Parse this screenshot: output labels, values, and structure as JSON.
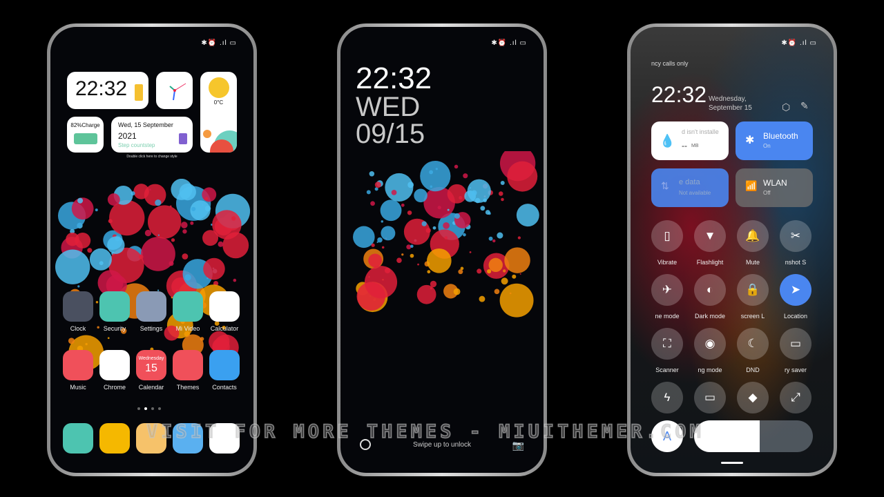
{
  "status_icons": "✱⏰ .ıl ▭",
  "home": {
    "clock_widget": "22:32",
    "weather_temp": "0°C",
    "charge": "82%Charge",
    "date_line": "Wed, 15 September",
    "year": "2021",
    "steps": "Step countstep",
    "hint": "Double click here to change style",
    "apps_row1": [
      {
        "label": "Clock",
        "color": "#4a5060"
      },
      {
        "label": "Security",
        "color": "#4dc4b0"
      },
      {
        "label": "Settings",
        "color": "#8a9ab5"
      },
      {
        "label": "Mi Video",
        "color": "#4dc4b0"
      },
      {
        "label": "Calculator",
        "color": "#ffffff"
      }
    ],
    "apps_row2": [
      {
        "label": "Music",
        "color": "#f0505a"
      },
      {
        "label": "Chrome",
        "color": "#ffffff"
      },
      {
        "label": "Calendar",
        "color": "#f0505a"
      },
      {
        "label": "Themes",
        "color": "#f0505a"
      },
      {
        "label": "Contacts",
        "color": "#3aa0f0"
      }
    ],
    "calendar_day": "Wednesday",
    "calendar_date": "15",
    "dock_colors": [
      "#4dc4b0",
      "#f5b800",
      "#f6c26a",
      "#5ab0f0",
      "#ffffff"
    ]
  },
  "lock": {
    "time": "22:32",
    "day": "WED",
    "date": "09/15",
    "swipe": "Swipe up to unlock"
  },
  "control": {
    "carrier": "ncy calls only",
    "time": "22:32",
    "date1": "Wednesday,",
    "date2": "September 15",
    "data_tile": {
      "title": "d isn't installe",
      "value": "--",
      "unit": "MB"
    },
    "bluetooth": {
      "title": "Bluetooth",
      "status": "On"
    },
    "mobile": {
      "title": "e data",
      "status": "Not available"
    },
    "wlan": {
      "title": "WLAN",
      "status": "Off"
    },
    "toggles": [
      {
        "label": "Vibrate",
        "icon": "▯",
        "active": false
      },
      {
        "label": "Flashlight",
        "icon": "▼",
        "active": false
      },
      {
        "label": "Mute",
        "icon": "🔔",
        "active": false
      },
      {
        "label": "nshot   S",
        "icon": "✂",
        "active": false
      },
      {
        "label": "ne mode",
        "icon": "✈",
        "active": false
      },
      {
        "label": "Dark mode",
        "icon": "◐",
        "active": false
      },
      {
        "label": "screen   L",
        "icon": "🔒",
        "active": false
      },
      {
        "label": "Location",
        "icon": "➤",
        "active": true
      },
      {
        "label": "Scanner",
        "icon": "⛶",
        "active": false
      },
      {
        "label": "ng mode",
        "icon": "◉",
        "active": false
      },
      {
        "label": "DND",
        "icon": "☾",
        "active": false
      },
      {
        "label": "ry saver",
        "icon": "▭",
        "active": false
      },
      {
        "label": "",
        "icon": "ϟ",
        "active": false
      },
      {
        "label": "",
        "icon": "▭",
        "active": false
      },
      {
        "label": "",
        "icon": "◆",
        "active": false
      },
      {
        "label": "",
        "icon": "⤢",
        "active": false
      }
    ],
    "brightness_percent": 55,
    "accent": "#4a86f0"
  },
  "watermark": "VISIT FOR MORE THEMES - MIUITHEMER.COM"
}
